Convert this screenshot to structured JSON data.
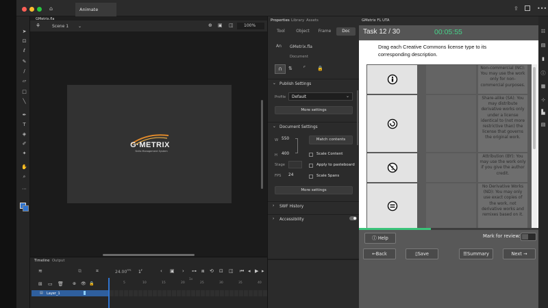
{
  "window": {
    "tab_title": "Animate",
    "document_tab": "GMetrix.fla",
    "scene_label": "Scene 1",
    "zoom": "100%"
  },
  "stage": {
    "logo_text": "G·METRIX",
    "logo_tagline": "Skills Management System"
  },
  "timeline": {
    "tabs": [
      "Timeline",
      "Output"
    ],
    "fps_value": "24.00",
    "fps_unit": "FPS",
    "frame_value": "1",
    "frame_unit": "F",
    "ruler_numbers": [
      "5",
      "10",
      "15",
      "20",
      "25",
      "30",
      "35",
      "40"
    ],
    "ruler_top_marker": "1s",
    "layer_name": "Layer_1"
  },
  "properties": {
    "tabs": [
      "Properties",
      "Library",
      "Assets"
    ],
    "subtabs": [
      "Tool",
      "Object",
      "Frame",
      "Doc"
    ],
    "doc_file": "GMetrix.fla",
    "doc_type": "Document",
    "publish_settings": {
      "title": "Publish Settings",
      "profile_label": "Profile",
      "profile_value": "Default",
      "more_settings": "More settings"
    },
    "document_settings": {
      "title": "Document Settings",
      "w_label": "W",
      "w_value": "550",
      "h_label": "H",
      "h_value": "400",
      "match_contents": "Match contents",
      "scale_content": "Scale Content",
      "stage_label": "Stage",
      "apply_pasteboard": "Apply to pasteboard",
      "fps_label": "FPS",
      "fps_value": "24",
      "scale_spans": "Scale Spans",
      "more_settings": "More settings"
    },
    "swf_history": "SWF History",
    "accessibility": "Accessibility"
  },
  "exam": {
    "panel_title": "GMetrix FL UTA",
    "task_label": "Task 12 / 30",
    "timer": "00:05:55",
    "question": "Drag each Creative Commons license type to its corresponding description.",
    "descriptions": [
      "Non-commercial (NC): You may use the work only for non-commercial purposes.",
      "Share-alike (SA): You may distribute derivative works only under a license identical to (not more restrictive than) the license that governs the original work.",
      "Attribution (BY): You may use the work only if you give the author credit.",
      "No Derivative Works (ND): You may only use exact copies of the work, not derivative works and remixes based on it."
    ],
    "license_icons": [
      "nc-person-icon",
      "share-alike-icon",
      "no-dollar-icon",
      "equals-icon"
    ],
    "progress_percent": 40,
    "help_label": "Help",
    "mark_for_review": "Mark for review:",
    "back_label": "Back",
    "save_label": "Save",
    "summary_label": "Summary",
    "next_label": "Next"
  },
  "colors": {
    "accent_blue": "#2f74d0",
    "timer_green": "#46d38a",
    "progress_green": "#3bc47a"
  }
}
